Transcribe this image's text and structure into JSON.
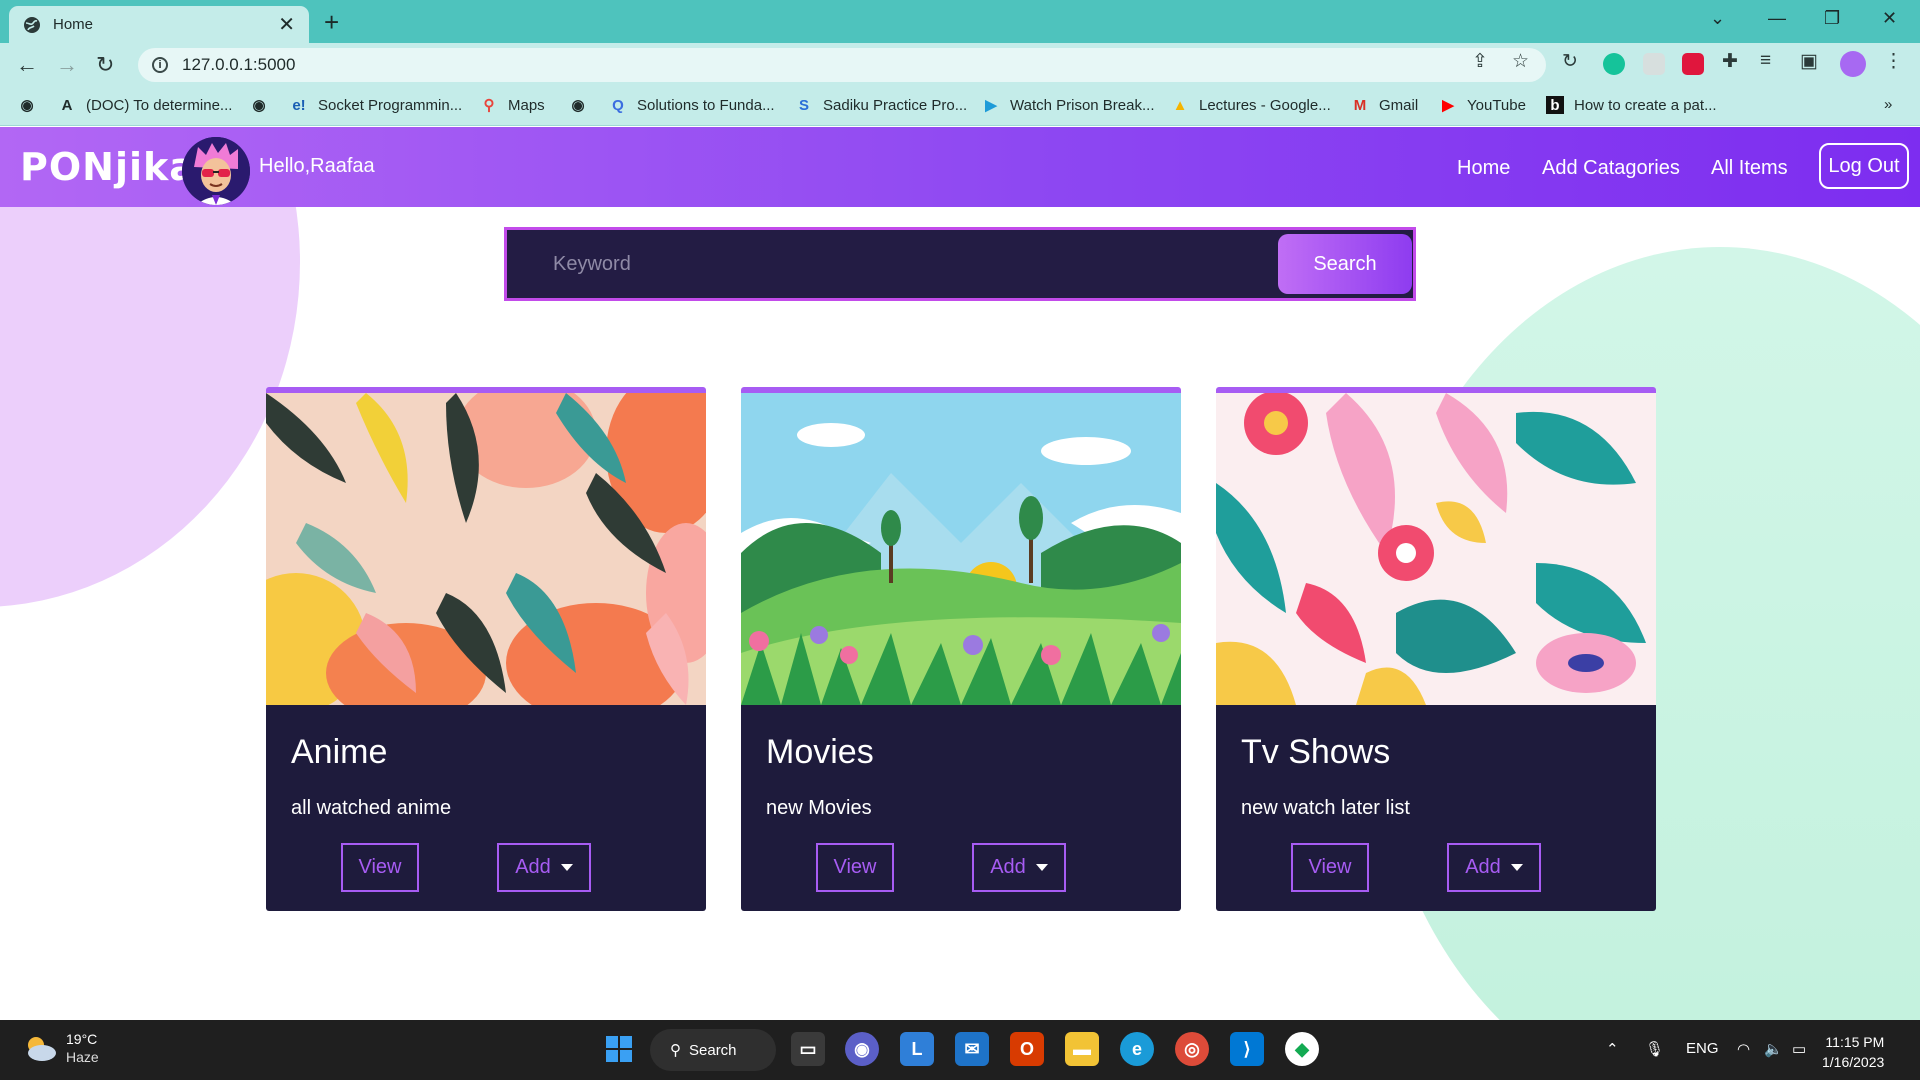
{
  "browser": {
    "tab_title": "Home",
    "url": "127.0.0.1:5000",
    "bookmarks": [
      {
        "label": "",
        "icon": "globe-icon"
      },
      {
        "label": "(DOC) To determine...",
        "icon": "academia-icon"
      },
      {
        "label": "",
        "icon": "globe-icon"
      },
      {
        "label": "Socket Programmin...",
        "icon": "e-icon"
      },
      {
        "label": "Maps",
        "icon": "maps-icon"
      },
      {
        "label": "",
        "icon": "globe-icon"
      },
      {
        "label": "Solutions to Funda...",
        "icon": "q-icon"
      },
      {
        "label": "Sadiku Practice Pro...",
        "icon": "s-icon"
      },
      {
        "label": "Watch Prison Break...",
        "icon": "play-icon"
      },
      {
        "label": "Lectures - Google...",
        "icon": "drive-icon"
      },
      {
        "label": "Gmail",
        "icon": "gmail-icon"
      },
      {
        "label": "YouTube",
        "icon": "youtube-icon"
      },
      {
        "label": "How to create a pat...",
        "icon": "b-icon"
      }
    ]
  },
  "navbar": {
    "brand": "PONjika",
    "greeting": "Hello,Raafaa",
    "links": [
      "Home",
      "Add Catagories",
      "All Items"
    ],
    "logout_label": "Log Out"
  },
  "search": {
    "placeholder": "Keyword",
    "button_label": "Search"
  },
  "cards": [
    {
      "title": "Anime",
      "description": "all watched anime",
      "view_label": "View",
      "add_label": "Add"
    },
    {
      "title": "Movies",
      "description": "new Movies",
      "view_label": "View",
      "add_label": "Add"
    },
    {
      "title": "Tv Shows",
      "description": "new watch later list",
      "view_label": "View",
      "add_label": "Add"
    }
  ],
  "taskbar": {
    "weather_temp": "19°C",
    "weather_cond": "Haze",
    "search_label": "Search",
    "language": "ENG",
    "time": "11:15 PM",
    "date": "1/16/2023"
  },
  "colors": {
    "navbar_start": "#b267f4",
    "navbar_end": "#7d2df0",
    "card_bg": "#1e1b3c",
    "accent": "#a75cf3",
    "tab_bar": "#4ec3bd"
  }
}
